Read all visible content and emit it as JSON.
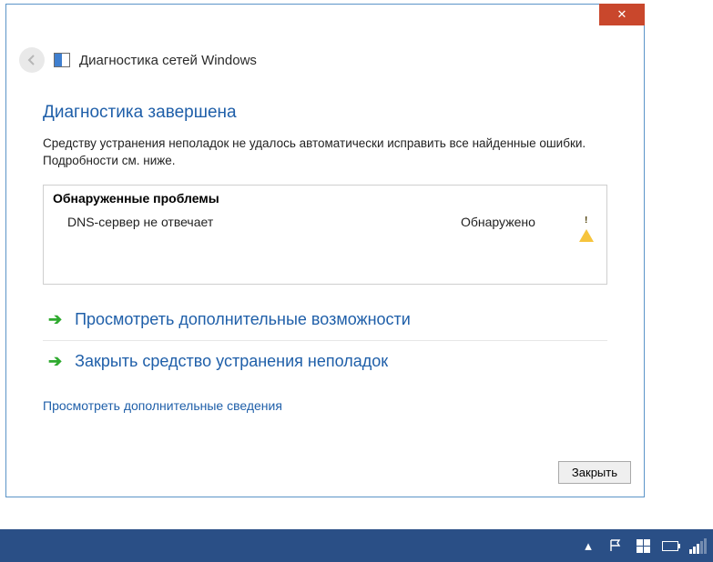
{
  "window": {
    "title": "Диагностика сетей Windows",
    "close_glyph": "✕"
  },
  "page": {
    "heading": "Диагностика завершена",
    "description": "Средству устранения неполадок не удалось автоматически исправить все найденные ошибки. Подробности см. ниже."
  },
  "problems": {
    "header": "Обнаруженные проблемы",
    "items": [
      {
        "name": "DNS-сервер не отвечает",
        "status": "Обнаружено"
      }
    ]
  },
  "actions": {
    "explore": "Просмотреть дополнительные возможности",
    "close_ts": "Закрыть средство устранения неполадок"
  },
  "details_link": "Просмотреть дополнительные сведения",
  "buttons": {
    "close": "Закрыть"
  },
  "tray": {
    "chevron": "▴"
  }
}
